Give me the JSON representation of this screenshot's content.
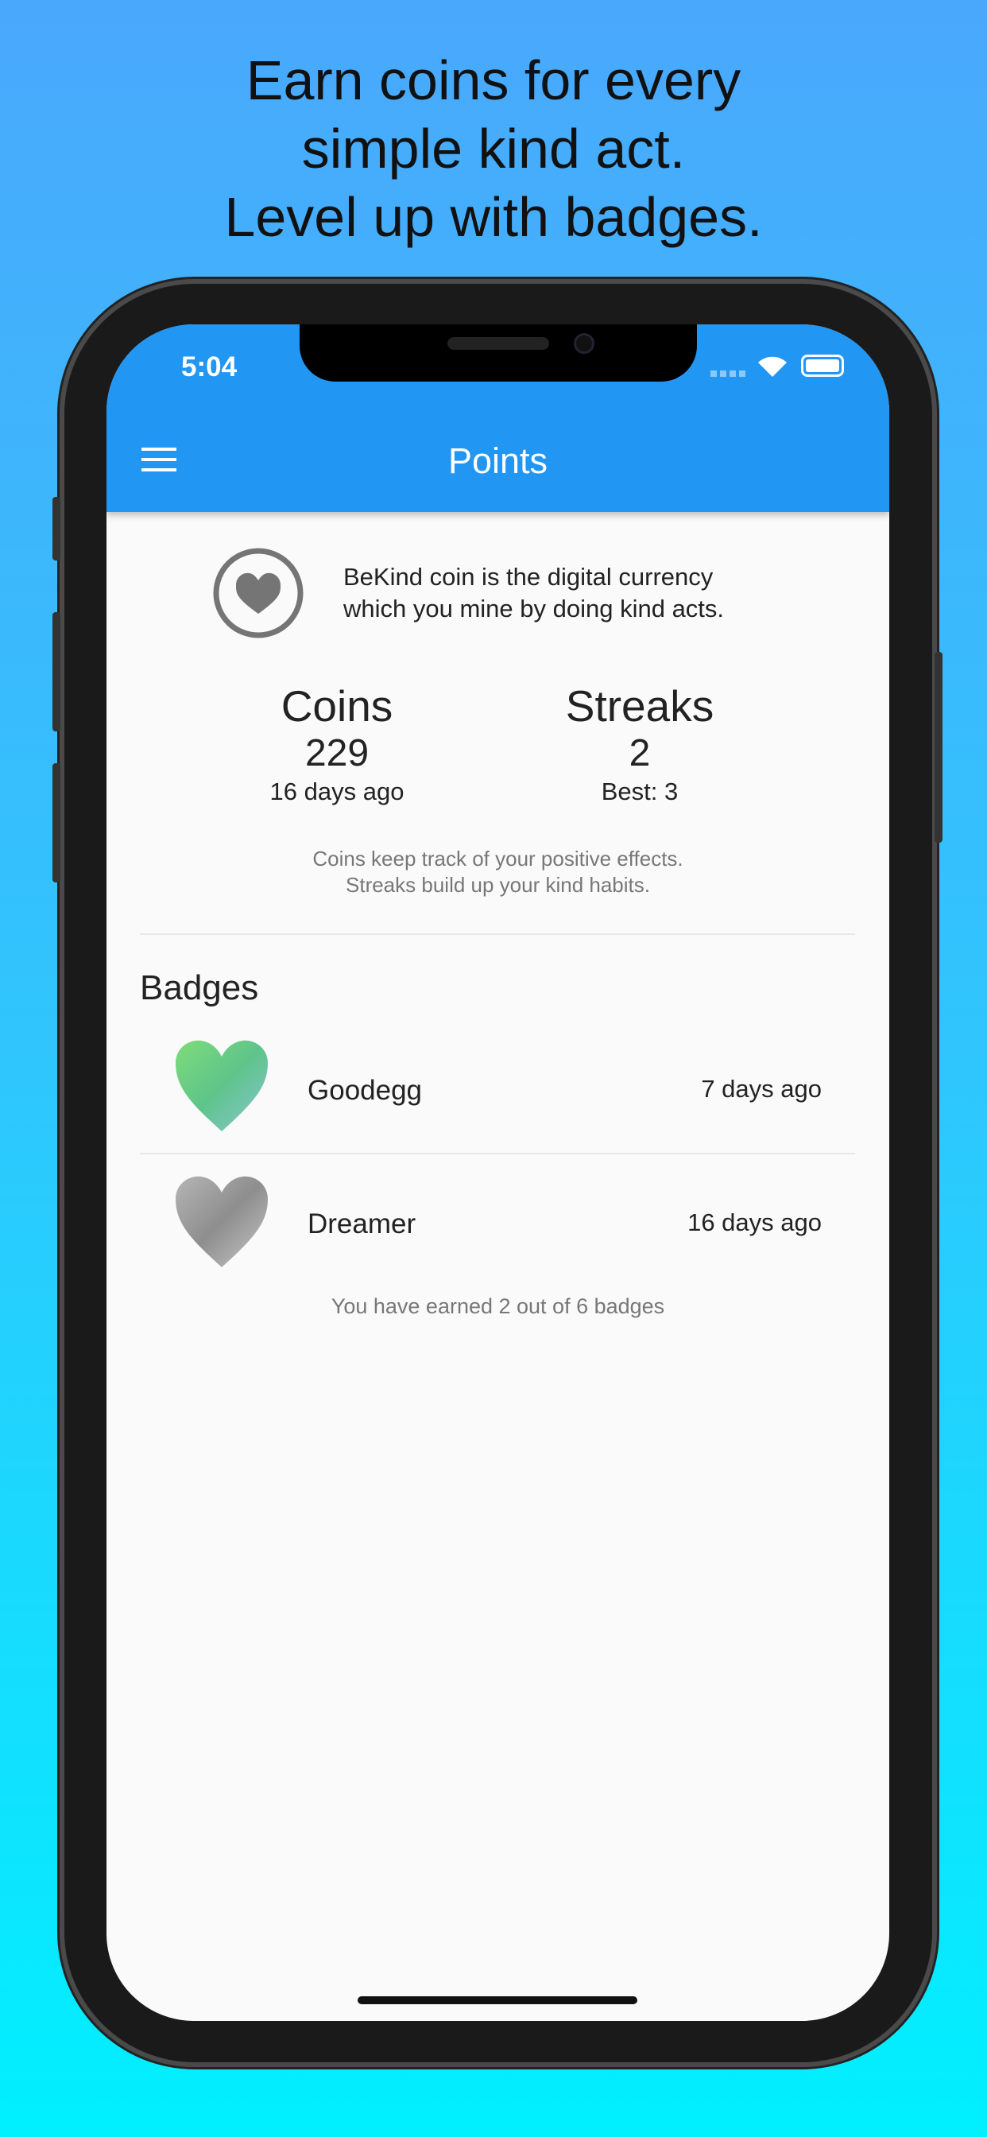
{
  "headline": [
    "Earn coins for every",
    "simple kind act.",
    "Level up with badges."
  ],
  "status_bar": {
    "time": "5:04"
  },
  "app_bar": {
    "title": "Points"
  },
  "intro": {
    "line1": "BeKind coin is the digital currency",
    "line2": "which you mine by doing kind acts."
  },
  "stats": [
    {
      "label": "Coins",
      "value": "229",
      "sub": "16 days ago"
    },
    {
      "label": "Streaks",
      "value": "2",
      "sub": "Best: 3"
    }
  ],
  "caption": {
    "line1": "Coins keep track of your positive effects.",
    "line2": "Streaks build up your kind habits."
  },
  "badges": {
    "heading": "Badges",
    "items": [
      {
        "name": "Goodegg",
        "date": "7 days ago",
        "color": "#6ccf7a"
      },
      {
        "name": "Dreamer",
        "date": "16 days ago",
        "color": "#9a9a9a"
      }
    ],
    "footer": "You have earned 2 out of 6 badges"
  },
  "colors": {
    "app_bar": "#2196f3"
  }
}
